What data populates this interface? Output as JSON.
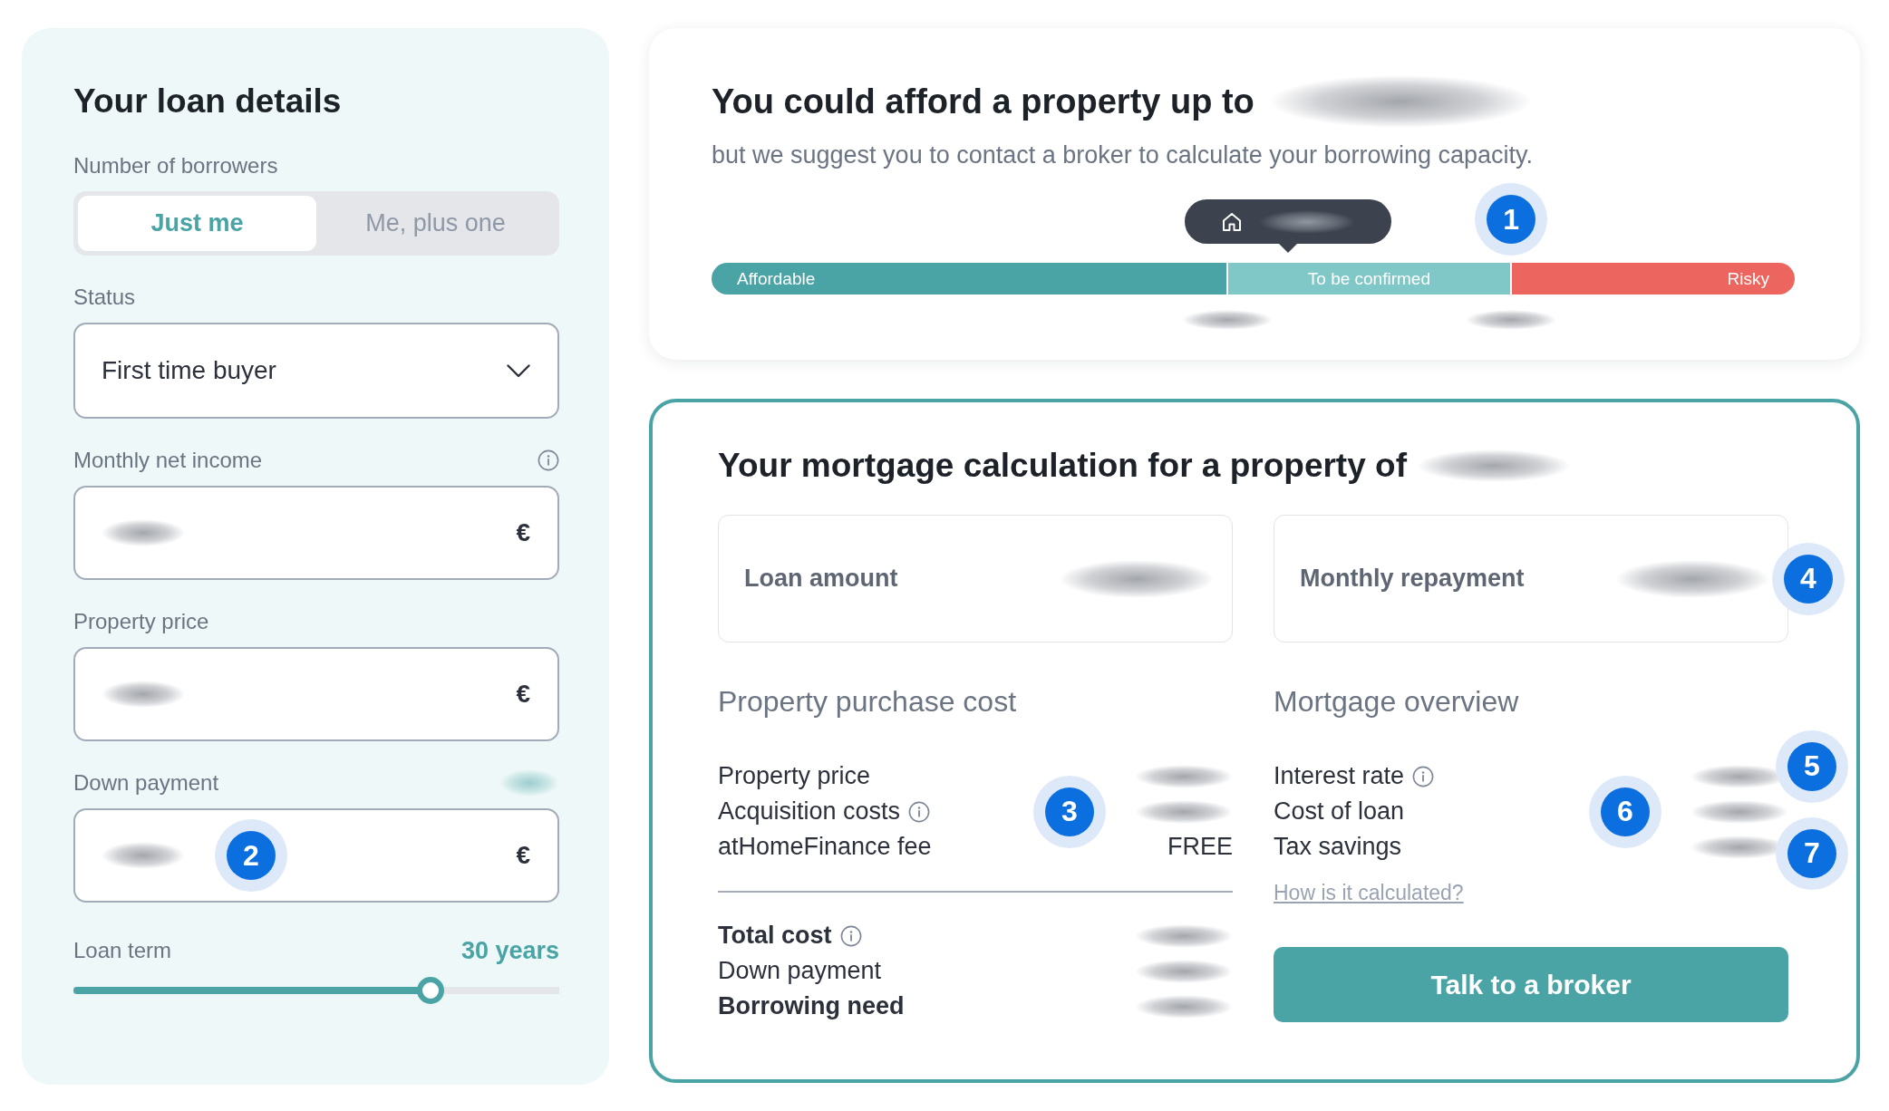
{
  "loan_details": {
    "title": "Your loan details",
    "borrowers": {
      "label": "Number of borrowers",
      "options": [
        {
          "label": "Just me",
          "selected": true
        },
        {
          "label": "Me, plus one",
          "selected": false
        }
      ]
    },
    "fields": [
      {
        "kind": "select",
        "label": "Status",
        "info": false,
        "value": "First time buyer"
      },
      {
        "kind": "amount",
        "label": "Monthly net income",
        "info": true,
        "share_redacted": false,
        "value_redacted": true,
        "unit": "€"
      },
      {
        "kind": "amount",
        "label": "Property price",
        "info": false,
        "share_redacted": false,
        "value_redacted": true,
        "unit": "€"
      },
      {
        "kind": "amount",
        "label": "Down payment",
        "info": false,
        "share_redacted": true,
        "value_redacted": true,
        "unit": "€",
        "callout": "2"
      }
    ],
    "loan_term": {
      "label": "Loan term",
      "value": "30 years",
      "level": 0.735
    }
  },
  "affordability": {
    "title": "You could afford a property up to",
    "amount_redacted": true,
    "subtitle": "but we suggest you to contact a broker to calculate your borrowing capacity.",
    "price_marker": {
      "level": 0.532,
      "value_redacted": true
    },
    "segments": [
      {
        "label": "Affordable",
        "color": "#4aa3a5",
        "boundary_redacted": true
      },
      {
        "label": "To be confirmed",
        "color": "#80c8c8",
        "boundary_redacted": true,
        "callout": "1"
      },
      {
        "label": "Risky",
        "color": "#ec655f",
        "boundary_redacted": false
      }
    ]
  },
  "mortgage": {
    "title": "Your mortgage calculation for a property of",
    "amount_redacted": true,
    "summary": [
      {
        "label": "Loan amount",
        "value_redacted": true
      },
      {
        "label": "Monthly repayment",
        "value_redacted": true,
        "callout": "4"
      }
    ],
    "purchase_cost": {
      "heading": "Property purchase cost",
      "rows": [
        {
          "label": "Property price",
          "info": false,
          "value_redacted": true
        },
        {
          "label": "Acquisition costs",
          "info": true,
          "value_redacted": true,
          "callout": "3"
        },
        {
          "label": "atHomeFinance fee",
          "info": false,
          "value_redacted": false,
          "value": "FREE"
        }
      ],
      "totals": [
        {
          "label": "Total cost",
          "bold": true,
          "info": true,
          "value_redacted": true
        },
        {
          "label": "Down payment",
          "bold": false,
          "info": false,
          "value_redacted": true
        },
        {
          "label": "Borrowing need",
          "bold": true,
          "info": false,
          "value_redacted": true
        }
      ]
    },
    "overview": {
      "heading": "Mortgage overview",
      "rows": [
        {
          "label": "Interest rate",
          "info": true,
          "value_redacted": true,
          "callout": "5"
        },
        {
          "label": "Cost of loan",
          "info": false,
          "value_redacted": true,
          "callout": "6"
        },
        {
          "label": "Tax savings",
          "info": false,
          "value_redacted": true,
          "callout": "7"
        }
      ],
      "link": "How is it calculated?",
      "button": "Talk to a broker"
    }
  }
}
